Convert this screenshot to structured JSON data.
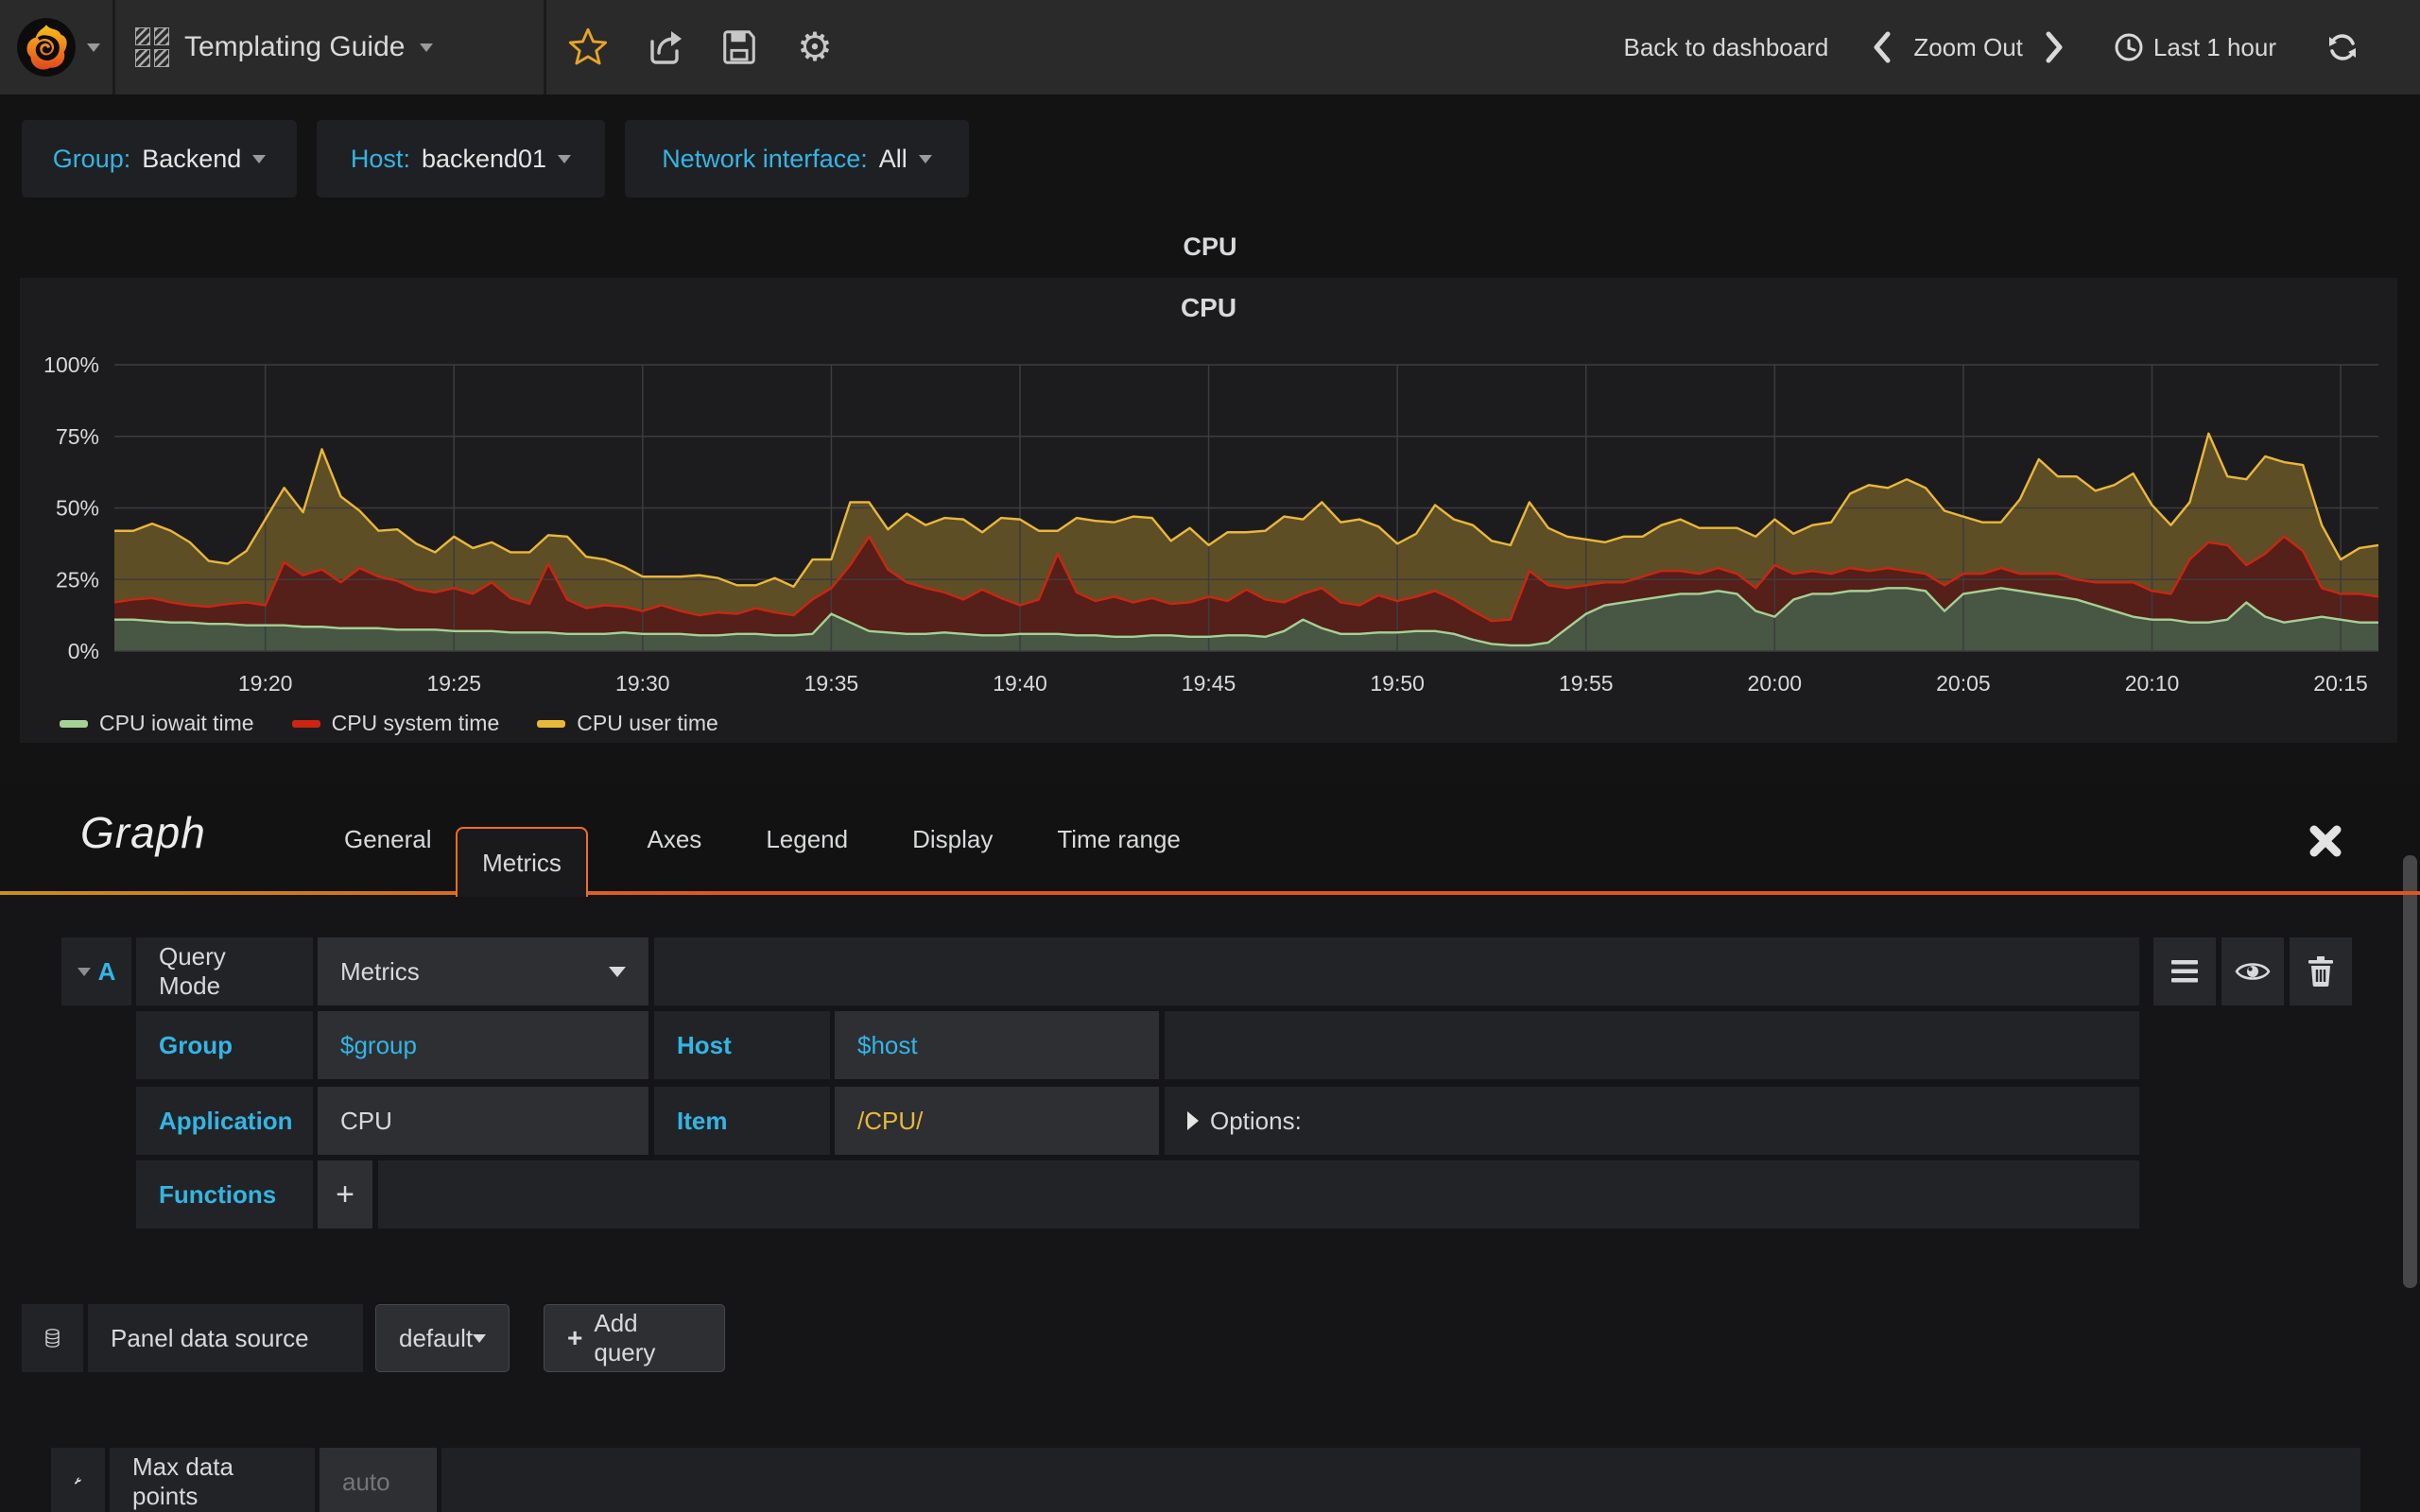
{
  "navbar": {
    "title": "Templating Guide",
    "back": "Back to dashboard",
    "zoom_out": "Zoom Out",
    "time_range": "Last 1 hour"
  },
  "variables": [
    {
      "label": "Group:",
      "value": "Backend"
    },
    {
      "label": "Host:",
      "value": "backend01"
    },
    {
      "label": "Network interface:",
      "value": "All"
    }
  ],
  "panel": {
    "title": "CPU",
    "chart_title": "CPU"
  },
  "chart_data": {
    "type": "area",
    "stacked": true,
    "title": "CPU",
    "xlabel": "",
    "ylabel": "",
    "ylim": [
      0,
      100
    ],
    "y_ticks": [
      "0%",
      "25%",
      "50%",
      "75%",
      "100%"
    ],
    "y_tick_values": [
      0,
      25,
      50,
      75,
      100
    ],
    "x_tick_labels": [
      "19:20",
      "19:25",
      "19:30",
      "19:35",
      "19:40",
      "19:45",
      "19:50",
      "19:55",
      "20:00",
      "20:05",
      "20:10",
      "20:15"
    ],
    "x_tick_minutes": [
      4,
      9,
      14,
      19,
      24,
      29,
      34,
      39,
      44,
      49,
      54,
      59
    ],
    "x_start_minute": 0,
    "x_end_minute": 60,
    "sample_interval_seconds": 30,
    "grid": true,
    "legend_position": "bottom",
    "series": [
      {
        "name": "CPU iowait time",
        "color": "#a5d194",
        "values": [
          11,
          11,
          10.5,
          10,
          10,
          9.5,
          9.5,
          9,
          9,
          9,
          8.5,
          8.5,
          8,
          8,
          8,
          7.5,
          7.5,
          7.5,
          7,
          7,
          7,
          6.5,
          6.5,
          6.5,
          6,
          6,
          6,
          6.5,
          6,
          6,
          6,
          5.5,
          5.5,
          6,
          6,
          5.5,
          5.5,
          6,
          13,
          10,
          7,
          6.5,
          6,
          6,
          6.5,
          6,
          5.5,
          5.5,
          6,
          6,
          6,
          5.5,
          5.5,
          5,
          5,
          5.5,
          5.5,
          5,
          5,
          5.5,
          5.5,
          5,
          7,
          11,
          8,
          6,
          6,
          6.5,
          6.5,
          7,
          7,
          6,
          4,
          2.5,
          2,
          2,
          3,
          8,
          13,
          16,
          17,
          18,
          19,
          20,
          20,
          21,
          20,
          14,
          12,
          18,
          20,
          20,
          21,
          21,
          22,
          22,
          21,
          14,
          20,
          21,
          22,
          21,
          20,
          19,
          18,
          16,
          14,
          12,
          11,
          11,
          10,
          10,
          11,
          17,
          12,
          10,
          11,
          12,
          11,
          10,
          10
        ]
      },
      {
        "name": "CPU system time",
        "color": "#cc2512",
        "values": [
          6,
          7,
          8,
          7,
          6,
          6,
          7,
          8,
          7,
          22,
          18,
          20,
          16,
          21,
          18,
          17,
          14,
          13,
          15,
          13,
          17,
          12,
          10,
          24,
          12,
          9,
          10,
          9,
          8,
          10,
          8,
          7,
          8,
          7,
          9,
          8,
          7,
          12,
          9,
          20,
          33,
          22,
          18,
          16,
          14,
          12,
          16,
          13,
          10,
          12,
          28,
          15,
          12,
          14,
          12,
          13,
          11,
          12,
          14,
          12,
          16,
          13,
          10,
          9,
          14,
          11,
          10,
          13,
          11,
          12,
          14,
          12,
          10,
          8,
          9,
          26,
          20,
          14,
          10,
          8,
          7,
          8,
          9,
          8,
          7,
          8,
          7,
          8,
          18,
          9,
          8,
          7,
          8,
          7,
          7,
          6,
          6,
          9,
          7,
          6,
          7,
          6,
          7,
          8,
          7,
          8,
          10,
          12,
          10,
          9,
          22,
          28,
          26,
          13,
          22,
          30,
          24,
          10,
          9,
          10,
          9
        ]
      },
      {
        "name": "CPU user time",
        "color": "#eab839",
        "values": [
          25,
          24,
          26,
          25,
          22,
          16,
          14,
          18,
          30,
          26,
          22,
          42,
          30,
          20,
          16,
          18,
          16,
          14,
          18,
          16,
          14,
          16,
          18,
          10,
          22,
          18,
          16,
          14,
          12,
          10,
          12,
          14,
          12,
          10,
          8,
          12,
          10,
          14,
          10,
          22,
          12,
          14,
          24,
          22,
          26,
          28,
          20,
          28,
          30,
          24,
          8,
          26,
          28,
          26,
          30,
          28,
          22,
          26,
          18,
          24,
          20,
          24,
          30,
          26,
          30,
          28,
          30,
          24,
          20,
          22,
          30,
          28,
          30,
          28,
          26,
          24,
          20,
          18,
          16,
          14,
          16,
          14,
          16,
          18,
          16,
          14,
          16,
          18,
          16,
          14,
          16,
          18,
          26,
          30,
          28,
          32,
          30,
          26,
          20,
          18,
          16,
          26,
          40,
          34,
          36,
          32,
          34,
          38,
          30,
          24,
          20,
          38,
          24,
          30,
          34,
          26,
          30,
          22,
          12,
          16,
          18
        ]
      }
    ]
  },
  "editor": {
    "panel_type": "Graph",
    "tabs": [
      "General",
      "Metrics",
      "Axes",
      "Legend",
      "Display",
      "Time range"
    ],
    "active_tab": "Metrics",
    "query": {
      "ref": "A",
      "mode_label": "Query Mode",
      "mode_value": "Metrics",
      "group_label": "Group",
      "group_value": "$group",
      "host_label": "Host",
      "host_value": "$host",
      "app_label": "Application",
      "app_value": "CPU",
      "item_label": "Item",
      "item_value": "/CPU/",
      "options_label": "Options:",
      "functions_label": "Functions",
      "add_function": "+"
    },
    "datasource": {
      "label": "Panel data source",
      "value": "default",
      "add_query": "Add query",
      "add_query_plus": "+"
    },
    "max_data_points": {
      "label": "Max data points",
      "placeholder": "auto"
    }
  }
}
